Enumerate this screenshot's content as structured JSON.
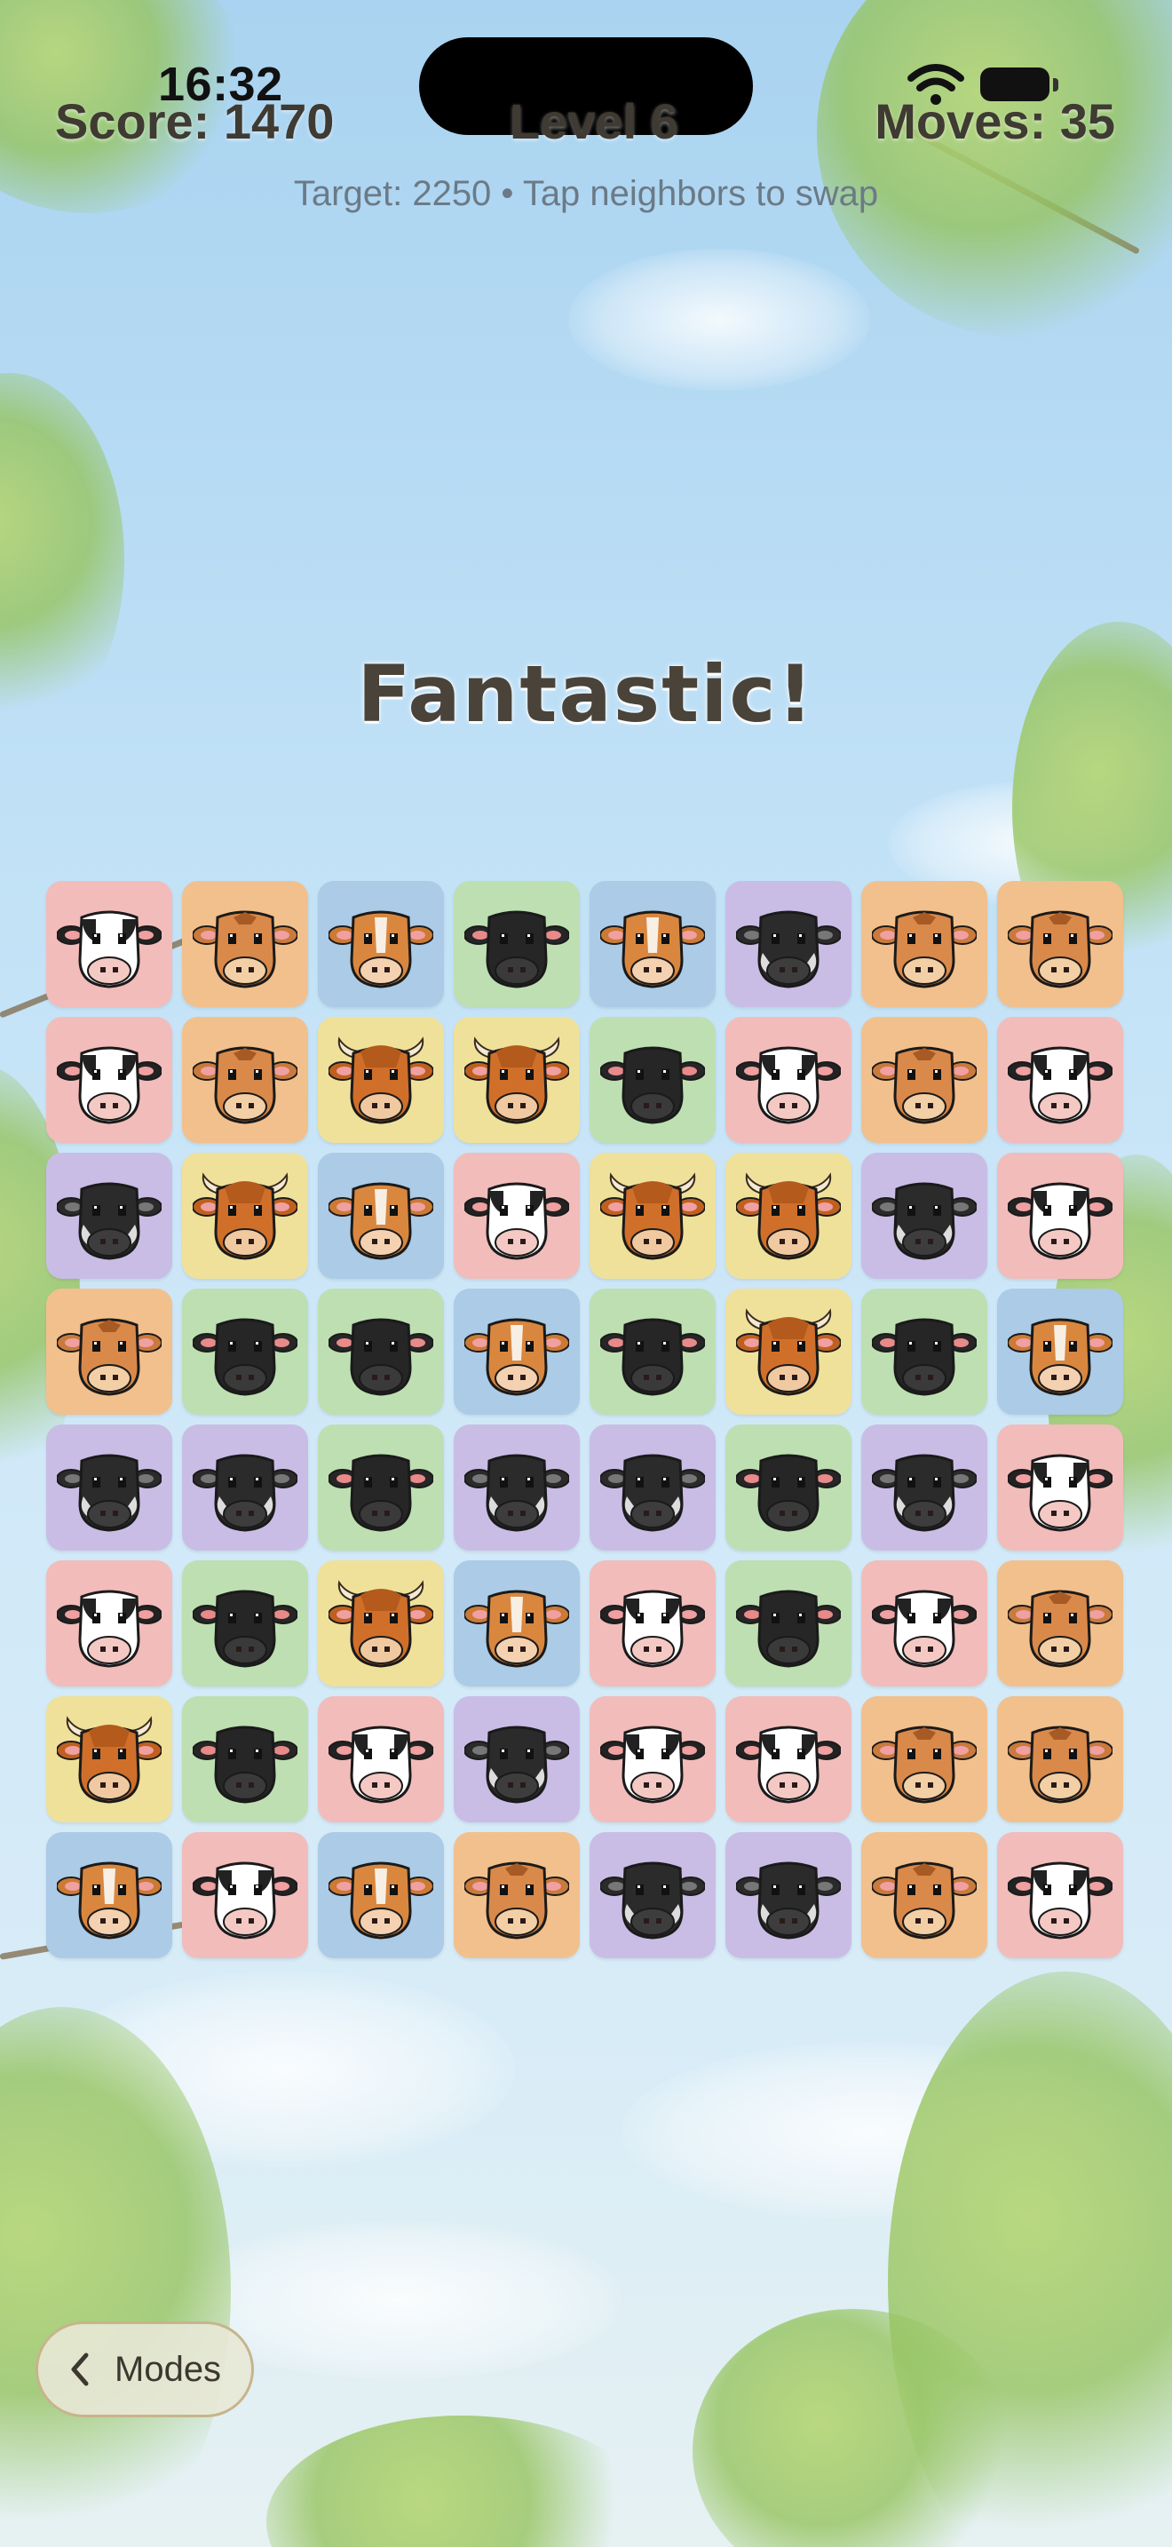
{
  "status_bar": {
    "time": "16:32",
    "wifi_icon": "wifi-icon",
    "battery_icon": "battery-icon"
  },
  "hud": {
    "score": "Score: 1470",
    "level": "Level 6",
    "moves": "Moves: 35",
    "subtitle": "Target: 2250 • Tap neighbors to swap"
  },
  "combo_text": "Fantastic!",
  "board": {
    "rows": 8,
    "cols": 8,
    "legend": {
      "H": "holstein-cow",
      "J": "jersey-cow",
      "G": "guernsey-cow",
      "A": "angus-cow",
      "W": "wagyu-cow",
      "Y": "highland-cow"
    },
    "cells": [
      [
        "H",
        "J",
        "G",
        "A",
        "G",
        "W",
        "J",
        "J"
      ],
      [
        "H",
        "J",
        "Y",
        "Y",
        "A",
        "H",
        "J",
        "H"
      ],
      [
        "W",
        "Y",
        "G",
        "H",
        "Y",
        "Y",
        "W",
        "H"
      ],
      [
        "J",
        "A",
        "A",
        "G",
        "A",
        "Y",
        "A",
        "G"
      ],
      [
        "W",
        "W",
        "A",
        "W",
        "W",
        "A",
        "W",
        "H"
      ],
      [
        "H",
        "A",
        "Y",
        "G",
        "H",
        "A",
        "H",
        "J"
      ],
      [
        "Y",
        "A",
        "H",
        "W",
        "H",
        "H",
        "J",
        "J"
      ],
      [
        "G",
        "H",
        "G",
        "J",
        "W",
        "W",
        "J",
        "H"
      ]
    ]
  },
  "tile_colors": {
    "H": "#f2bcbb",
    "J": "#f2c08c",
    "G": "#abcbe6",
    "A": "#bedfb2",
    "W": "#c9bde6",
    "Y": "#efe19a"
  },
  "nav": {
    "back_label": "Modes",
    "back_icon": "chevron-left-icon"
  }
}
